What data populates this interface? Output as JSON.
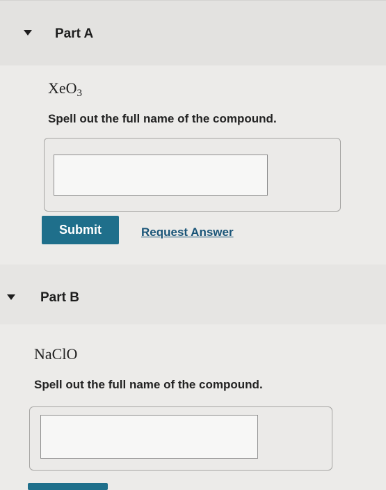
{
  "partA": {
    "title": "Part A",
    "formula_base": "XeO",
    "formula_sub": "3",
    "instruction": "Spell out the full name of the compound.",
    "answer_value": "",
    "submit_label": "Submit",
    "request_answer_label": "Request Answer"
  },
  "partB": {
    "title": "Part B",
    "formula": "NaClO",
    "instruction": "Spell out the full name of the compound.",
    "answer_value": ""
  },
  "colors": {
    "submit_button": "#1f6f8b",
    "link": "#1a5578",
    "background": "#ecebe9"
  }
}
